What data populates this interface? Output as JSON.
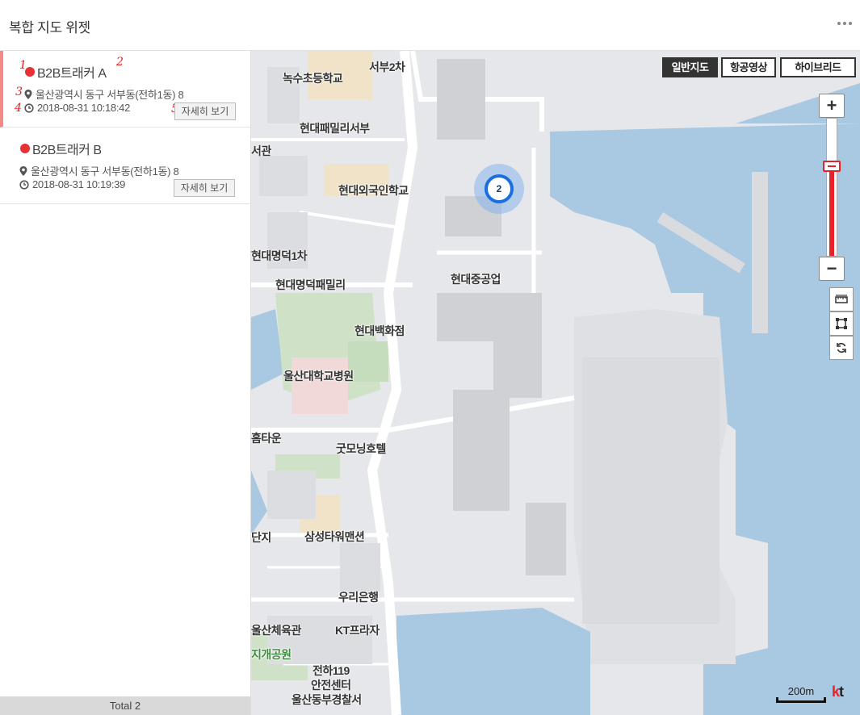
{
  "header": {
    "title": "복합 지도 위젯"
  },
  "trackers": [
    {
      "name": "B2B트래커 A",
      "address": "울산광역시 동구 서부동(전하1동) 8",
      "time": "2018-08-31 10:18:42",
      "detail_label": "자세히 보기",
      "selected": true,
      "status_color": "#e63235"
    },
    {
      "name": "B2B트래커 B",
      "address": "울산광역시 동구 서부동(전하1동) 8",
      "time": "2018-08-31 10:19:39",
      "detail_label": "자세히 보기",
      "selected": false,
      "status_color": "#e63235"
    }
  ],
  "annotations": [
    "1",
    "2",
    "3",
    "4",
    "5"
  ],
  "footer": {
    "total": "Total 2"
  },
  "map": {
    "types": [
      "일반지도",
      "항공영상",
      "하이브리드"
    ],
    "active_type": "일반지도",
    "zoom_in": "+",
    "zoom_out": "−",
    "zoom_level_fraction": 0.65,
    "tools": [
      "ruler-icon",
      "area-icon",
      "rotate-icon"
    ],
    "cluster_count": "2",
    "scale_label": "200m",
    "brand": "kt",
    "places": [
      {
        "label": "서부2차"
      },
      {
        "label": "녹수초등학교"
      },
      {
        "label": "현대패밀리서부"
      },
      {
        "label": "서관"
      },
      {
        "label": "현대외국인학교"
      },
      {
        "label": "현대명덕1차"
      },
      {
        "label": "현대명덕패밀리"
      },
      {
        "label": "현대중공업"
      },
      {
        "label": "현대백화점"
      },
      {
        "label": "울산대학교병원"
      },
      {
        "label": "홈타운"
      },
      {
        "label": "굿모닝호텔"
      },
      {
        "label": "단지"
      },
      {
        "label": "삼성타워맨션"
      },
      {
        "label": "우리은행"
      },
      {
        "label": "울산체육관"
      },
      {
        "label": "KT프라자"
      },
      {
        "label": "지개공원"
      },
      {
        "label": "전하119"
      },
      {
        "label": "안전센터"
      },
      {
        "label": "울산동부경찰서"
      }
    ]
  }
}
